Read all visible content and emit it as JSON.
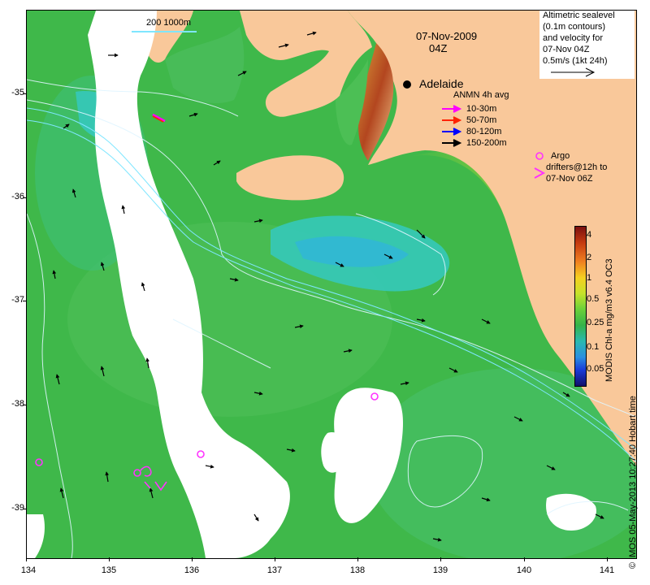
{
  "axes": {
    "y_ticks": [
      "-35",
      "-36",
      "-37",
      "-38",
      "-39"
    ],
    "x_ticks": [
      "134",
      "135",
      "136",
      "137",
      "138",
      "139",
      "140",
      "141"
    ]
  },
  "header": {
    "date": "07-Nov-2009",
    "time": "04Z"
  },
  "scale_bar": "200  1000m",
  "velocity_legend": {
    "lines": [
      "Altimetric sealevel",
      "(0.1m contours)",
      "and velocity for",
      "07-Nov 04Z",
      "0.5m/s (1kt 24h)"
    ]
  },
  "city": "Adelaide",
  "anmn_legend": {
    "title": "ANMN 4h avg",
    "items": [
      {
        "label": "10-30m",
        "color": "#ff00ff"
      },
      {
        "label": "50-70m",
        "color": "#ff2200"
      },
      {
        "label": "80-120m",
        "color": "#0000ff"
      },
      {
        "label": "150-200m",
        "color": "#000000"
      }
    ]
  },
  "argo_legend": {
    "lines": [
      "Argo",
      "drifters@12h to",
      "07-Nov 06Z"
    ],
    "color": "#ff33ff"
  },
  "colorbar": {
    "label": "MODIS Chl-a mg/m3 v6.4 OC3",
    "ticks": [
      "4",
      "2",
      "1",
      "0.5",
      "0.25",
      "0.1",
      "0.05"
    ]
  },
  "credit": "© IMOS 05-May-2013 10:27:40 Hobart time",
  "colors": {
    "land": "#f9c89a",
    "ocean_green": "#3fb84a",
    "shelf_cyan": "#35c9bf",
    "cloud": "#ffffff"
  }
}
